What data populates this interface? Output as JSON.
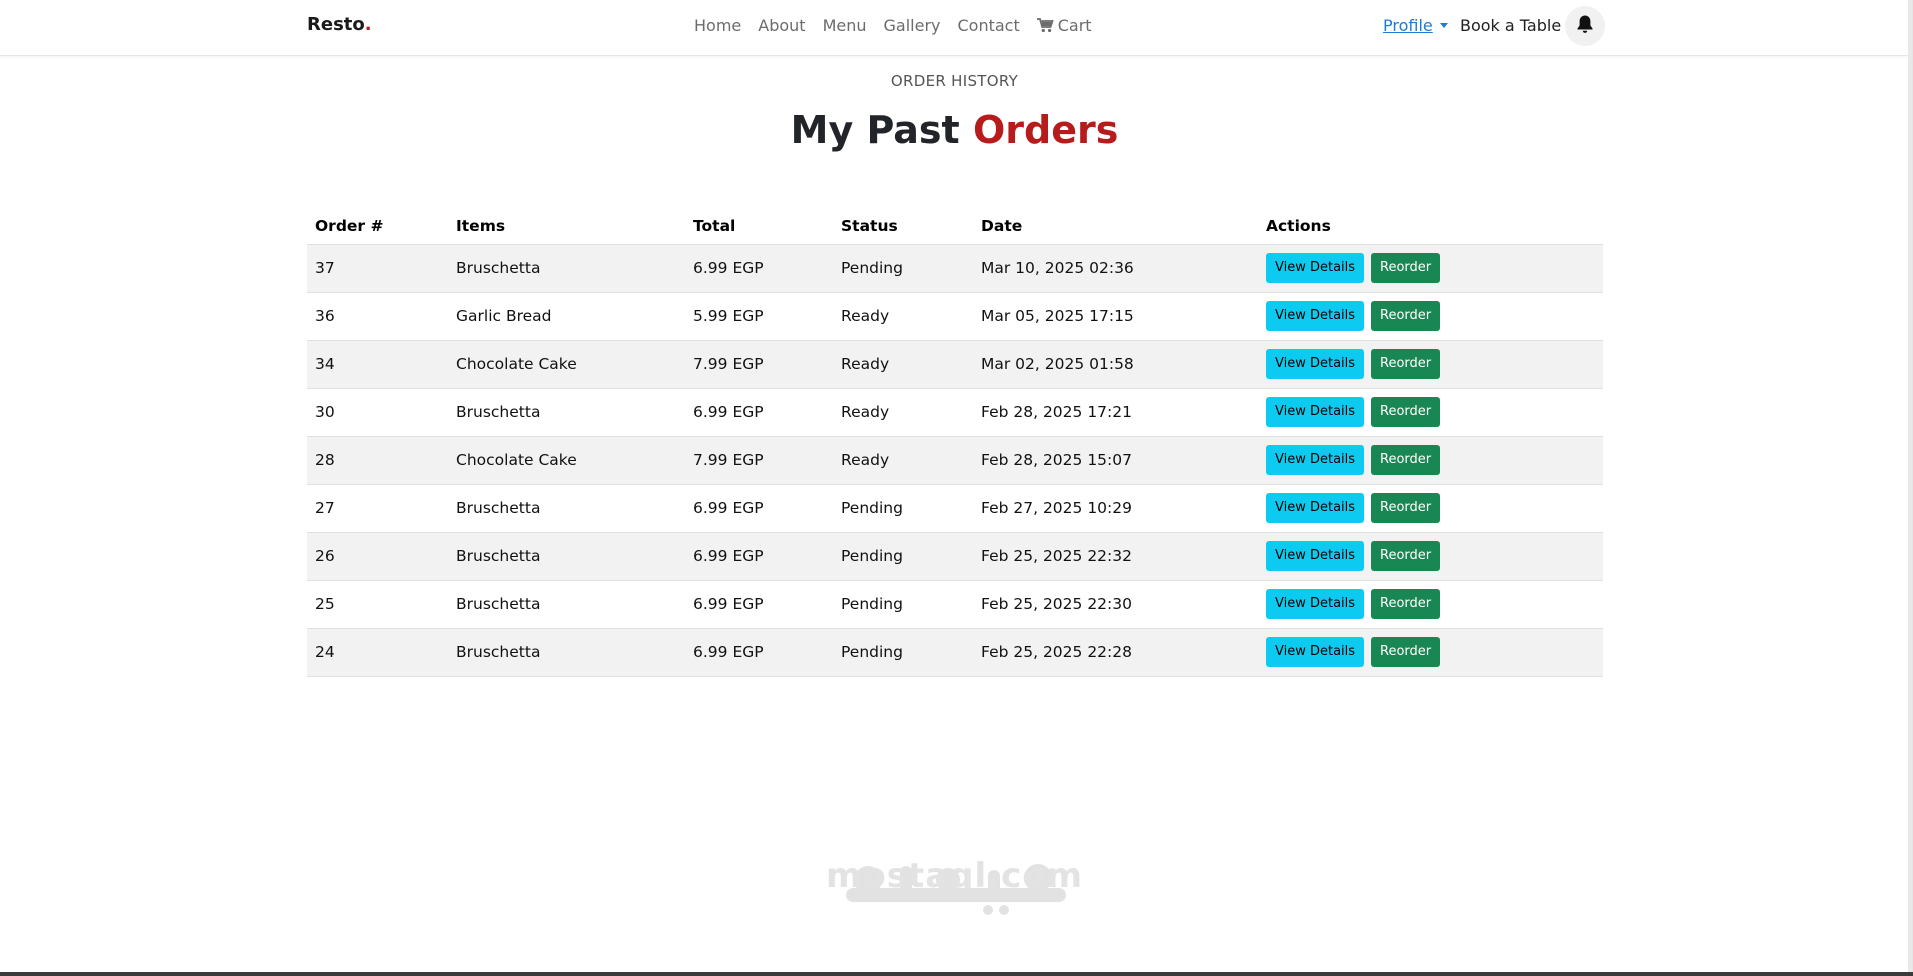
{
  "navbar": {
    "brand": "Resto",
    "brand_dot": ".",
    "links": [
      {
        "label": "Home"
      },
      {
        "label": "About"
      },
      {
        "label": "Menu"
      },
      {
        "label": "Gallery"
      },
      {
        "label": "Contact"
      },
      {
        "label": "Cart",
        "icon": "cart-icon"
      }
    ],
    "profile_label": "Profile",
    "book_label": "Book a Table",
    "bell_icon": "bell-icon"
  },
  "header": {
    "subtitle": "ORDER HISTORY",
    "title_part1": "My Past",
    "title_part2": "Orders",
    "accent_color": "#b71c1c"
  },
  "table": {
    "columns": [
      "Order #",
      "Items",
      "Total",
      "Status",
      "Date",
      "Actions"
    ],
    "rows": [
      {
        "order": "37",
        "items": "Bruschetta",
        "total": "6.99 EGP",
        "status": "Pending",
        "date": "Mar 10, 2025 02:36"
      },
      {
        "order": "36",
        "items": "Garlic Bread",
        "total": "5.99 EGP",
        "status": "Ready",
        "date": "Mar 05, 2025 17:15"
      },
      {
        "order": "34",
        "items": "Chocolate Cake",
        "total": "7.99 EGP",
        "status": "Ready",
        "date": "Mar 02, 2025 01:58"
      },
      {
        "order": "30",
        "items": "Bruschetta",
        "total": "6.99 EGP",
        "status": "Ready",
        "date": "Feb 28, 2025 17:21"
      },
      {
        "order": "28",
        "items": "Chocolate Cake",
        "total": "7.99 EGP",
        "status": "Ready",
        "date": "Feb 28, 2025 15:07"
      },
      {
        "order": "27",
        "items": "Bruschetta",
        "total": "6.99 EGP",
        "status": "Pending",
        "date": "Feb 27, 2025 10:29"
      },
      {
        "order": "26",
        "items": "Bruschetta",
        "total": "6.99 EGP",
        "status": "Pending",
        "date": "Feb 25, 2025 22:32"
      },
      {
        "order": "25",
        "items": "Bruschetta",
        "total": "6.99 EGP",
        "status": "Pending",
        "date": "Feb 25, 2025 22:30"
      },
      {
        "order": "24",
        "items": "Bruschetta",
        "total": "6.99 EGP",
        "status": "Pending",
        "date": "Feb 25, 2025 22:28"
      }
    ],
    "view_label": "View Details",
    "reorder_label": "Reorder",
    "view_color": "#0dcaf0",
    "reorder_color": "#198754"
  },
  "watermark": {
    "text": "mostaql.com",
    "logo_text": "مستقل"
  }
}
